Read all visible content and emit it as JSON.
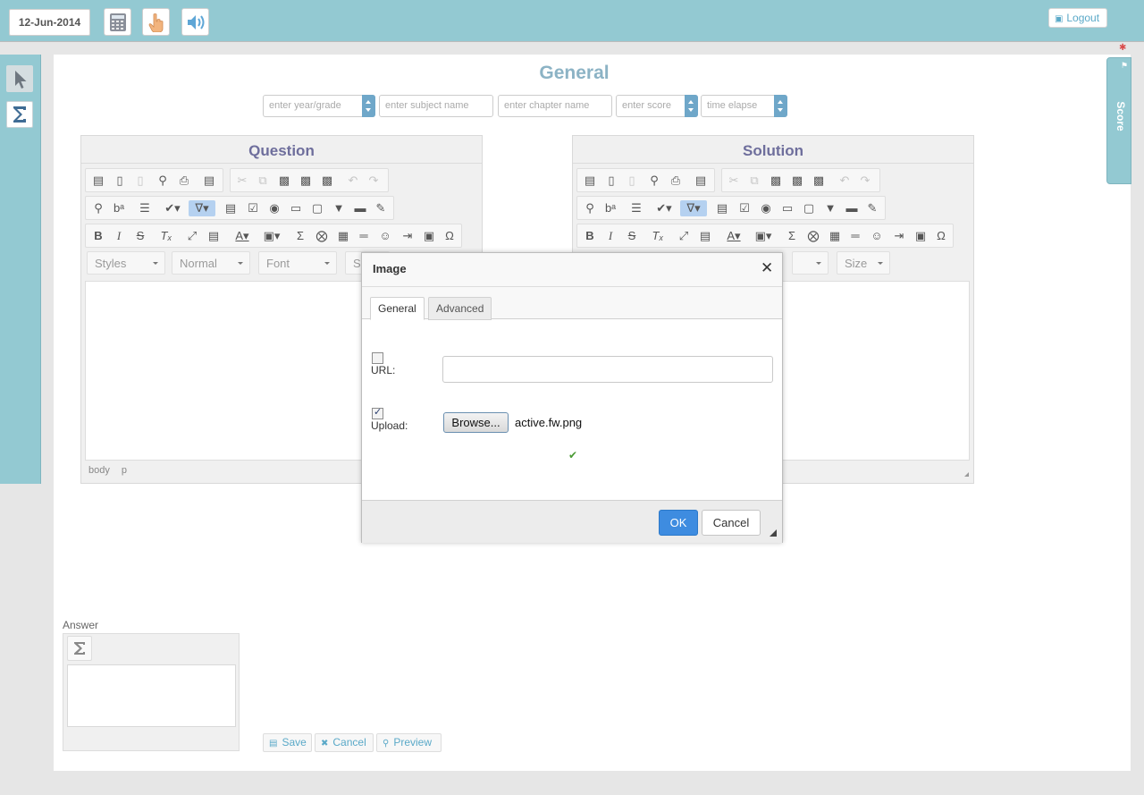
{
  "topbar": {
    "date": "12-Jun-2014",
    "logout_label": "Logout",
    "icons": [
      "calculator-icon",
      "hand-pointer-icon",
      "speaker-icon"
    ]
  },
  "sidebar": {
    "tools": [
      "pointer-icon",
      "sigma-icon"
    ]
  },
  "page": {
    "title": "General"
  },
  "filters": {
    "year_placeholder": "enter year/grade",
    "subject_placeholder": "enter subject name",
    "chapter_placeholder": "enter chapter name",
    "score_placeholder": "enter score",
    "time_placeholder": "time elapse"
  },
  "question_editor": {
    "title": "Question",
    "styles": "Styles",
    "format": "Normal",
    "font": "Font",
    "size": "S",
    "path": [
      "body",
      "p"
    ]
  },
  "solution_editor": {
    "title": "Solution",
    "size": "Size"
  },
  "answer": {
    "label": "Answer"
  },
  "actions": {
    "save": "Save",
    "cancel": "Cancel",
    "preview": "Preview"
  },
  "score_tab": {
    "label": "Score"
  },
  "dialog": {
    "title": "Image",
    "tabs": [
      "General",
      "Advanced"
    ],
    "url_label": "URL:",
    "url_value": "",
    "url_checked": false,
    "upload_label": "Upload:",
    "upload_checked": true,
    "browse_label": "Browse...",
    "file_name": "active.fw.png",
    "ok_label": "OK",
    "cancel_label": "Cancel"
  },
  "colors": {
    "header": "#93c9d2",
    "title": "#8cb3c5",
    "accent": "#3e8ce0",
    "link": "#5aa9c8"
  }
}
